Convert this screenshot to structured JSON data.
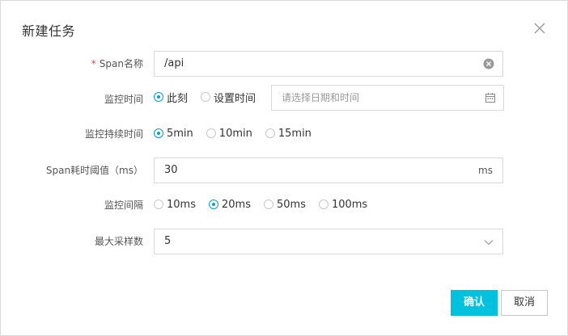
{
  "dialog": {
    "title": "新建任务",
    "close_icon": "close-icon"
  },
  "form": {
    "span_name": {
      "required_mark": "*",
      "label": "Span名称",
      "value": "/api",
      "clear_icon": "clear-circle-icon"
    },
    "monitor_time": {
      "label": "监控时间",
      "options": [
        "此刻",
        "设置时间"
      ],
      "selected": "此刻",
      "date_placeholder": "请选择日期和时间",
      "calendar_icon": "calendar-icon"
    },
    "monitor_duration": {
      "label": "监控持续时间",
      "options": [
        "5min",
        "10min",
        "15min"
      ],
      "selected": "5min"
    },
    "threshold": {
      "label": "Span耗时阈值（ms）",
      "value": "30",
      "suffix": "ms"
    },
    "interval": {
      "label": "监控间隔",
      "options": [
        "10ms",
        "20ms",
        "50ms",
        "100ms"
      ],
      "selected": "20ms"
    },
    "max_samples": {
      "label": "最大采样数",
      "value": "5",
      "arrow_icon": "chevron-down-icon"
    }
  },
  "footer": {
    "confirm_label": "确认",
    "cancel_label": "取消"
  },
  "colors": {
    "accent": "#00c1de",
    "radio_selected": "#00a2ca",
    "required": "#f04134",
    "border": "#d9d9d9"
  }
}
